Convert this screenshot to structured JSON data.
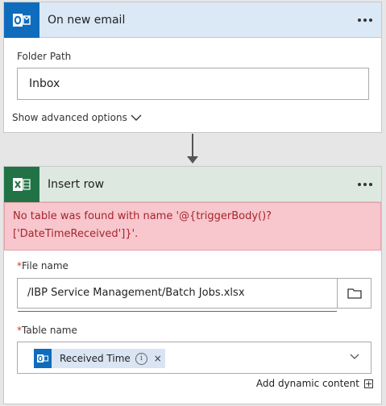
{
  "trigger": {
    "title": "On new email",
    "app_icon": "outlook-icon",
    "folder_path_label": "Folder Path",
    "folder_path_value": "Inbox",
    "show_advanced": "Show advanced options"
  },
  "action": {
    "title": "Insert row",
    "app_icon": "excel-icon",
    "error_message": "No table was found with name '@{triggerBody()?['DateTimeReceived']}'.",
    "file_name_label": "File name",
    "file_name_value": "/IBP Service Management/Batch Jobs.xlsx",
    "table_name_label": "Table name",
    "table_token_label": "Received Time",
    "token_close": "×",
    "required_mark": "*",
    "add_dynamic_content": "Add dynamic content"
  },
  "colors": {
    "outlook_blue": "#0f6cbd",
    "excel_green": "#217346",
    "error_text": "#a4262c",
    "error_bg": "#f8c6cd"
  }
}
